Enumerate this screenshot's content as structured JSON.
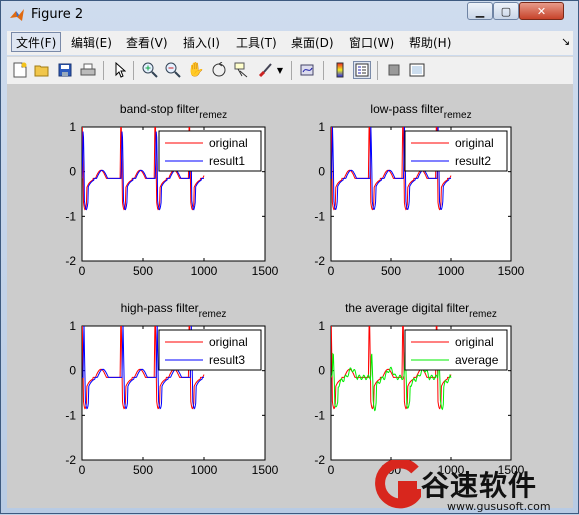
{
  "window": {
    "title": "Figure 2"
  },
  "menu": [
    "文件(F)",
    "编辑(E)",
    "查看(V)",
    "插入(I)",
    "工具(T)",
    "桌面(D)",
    "窗口(W)",
    "帮助(H)"
  ],
  "toolbar": {
    "icons": [
      "new-figure-icon",
      "open-file-icon",
      "save-icon",
      "print-icon",
      "edit-plot-arrow-icon",
      "zoom-in-icon",
      "zoom-out-icon",
      "pan-hand-icon",
      "rotate-3d-icon",
      "data-cursor-icon",
      "brush-icon",
      "brush-dropdown-icon",
      "link-plot-icon",
      "colorbar-icon",
      "legend-icon",
      "hide-plot-tools-icon",
      "show-plot-tools-icon"
    ]
  },
  "chart_data": [
    {
      "type": "line",
      "title": "band-stop filter",
      "title_sub": "remez",
      "xlim": [
        0,
        1500
      ],
      "ylim": [
        -2,
        1
      ],
      "xticks": [
        "0",
        "500",
        "1000",
        "1500"
      ],
      "yticks": [
        "1",
        "0",
        "-1",
        "-2"
      ],
      "legend": "top-right",
      "series": [
        {
          "name": "original",
          "color": "#ff0000"
        },
        {
          "name": "result1",
          "color": "#0000ff"
        }
      ]
    },
    {
      "type": "line",
      "title": "low-pass filter",
      "title_sub": "remez",
      "xlim": [
        0,
        1500
      ],
      "ylim": [
        -2,
        1
      ],
      "xticks": [
        "0",
        "500",
        "1000",
        "1500"
      ],
      "yticks": [
        "1",
        "0",
        "-1",
        "-2"
      ],
      "legend": "top-right",
      "series": [
        {
          "name": "original",
          "color": "#ff0000"
        },
        {
          "name": "result2",
          "color": "#0000ff"
        }
      ]
    },
    {
      "type": "line",
      "title": "high-pass filter",
      "title_sub": "remez",
      "xlim": [
        0,
        1500
      ],
      "ylim": [
        -2,
        1
      ],
      "xticks": [
        "0",
        "500",
        "1000",
        "1500"
      ],
      "yticks": [
        "1",
        "0",
        "-1",
        "-2"
      ],
      "legend": "top-right",
      "series": [
        {
          "name": "original",
          "color": "#ff0000"
        },
        {
          "name": "result3",
          "color": "#0000ff"
        }
      ]
    },
    {
      "type": "line",
      "title": "the average digital filter",
      "title_sub": "remez",
      "xlim": [
        0,
        1500
      ],
      "ylim": [
        -2,
        1
      ],
      "xticks": [
        "0",
        "500",
        "1000",
        "1500"
      ],
      "yticks": [
        "1",
        "0",
        "-1",
        "-2"
      ],
      "legend": "top-right",
      "series": [
        {
          "name": "original",
          "color": "#ff0000"
        },
        {
          "name": "average",
          "color": "#00ee00"
        }
      ]
    }
  ],
  "watermark": {
    "text": "谷速软件",
    "url": "www.gususoft.com"
  }
}
